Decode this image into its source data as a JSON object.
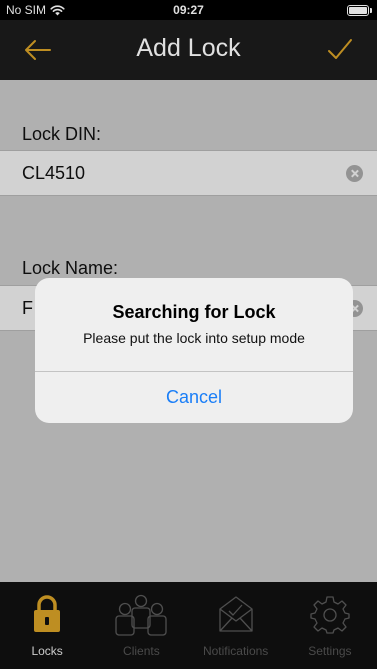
{
  "status_bar": {
    "carrier": "No SIM",
    "time": "09:27"
  },
  "nav": {
    "title": "Add Lock",
    "back_icon": "arrow-left-icon",
    "done_icon": "checkmark-icon",
    "accent_color": "#d9a227"
  },
  "form": {
    "lock_din_label": "Lock DIN:",
    "lock_din_value": "CL4510",
    "lock_name_label": "Lock Name:",
    "lock_name_value": "F"
  },
  "alert": {
    "title": "Searching for Lock",
    "message": "Please put the lock into setup mode",
    "cancel_label": "Cancel",
    "button_color": "#1a7ef7"
  },
  "tabs": [
    {
      "label": "Locks",
      "icon": "lock-icon",
      "active": true
    },
    {
      "label": "Clients",
      "icon": "clients-icon",
      "active": false
    },
    {
      "label": "Notifications",
      "icon": "envelope-icon",
      "active": false
    },
    {
      "label": "Settings",
      "icon": "gear-icon",
      "active": false
    }
  ]
}
